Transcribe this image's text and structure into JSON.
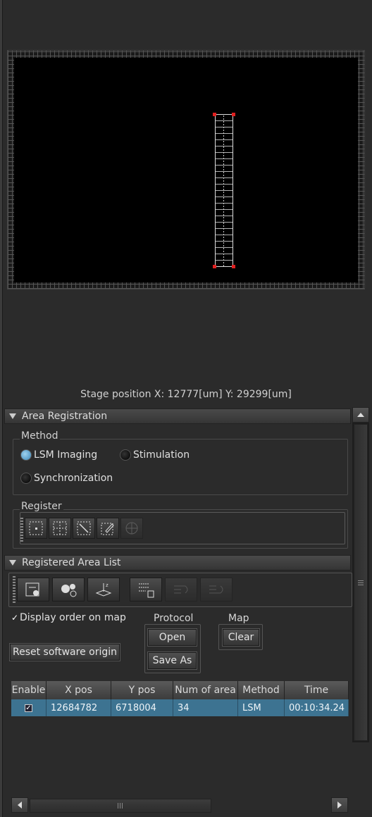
{
  "stage_position": "Stage position  X: 12777[um] Y: 29299[um]",
  "area_registration": {
    "header": "Area Registration",
    "method_title": "Method",
    "methods": [
      "LSM Imaging",
      "Stimulation",
      "Synchronization"
    ],
    "selected_method": "LSM Imaging",
    "register_title": "Register",
    "register_tools": [
      "point-register-icon",
      "grid-register-icon",
      "diagonal-register-icon",
      "edit-register-icon",
      "multi-area-icon"
    ]
  },
  "registered_area_list": {
    "header": "Registered Area List",
    "tools": [
      "list-settings-icon",
      "camera-settings-icon",
      "z-axis-icon",
      "delete-list-icon",
      "move-up-icon",
      "move-down-icon"
    ],
    "display_order_label": "Display order on map",
    "display_order_checked": true,
    "protocol_title": "Protocol",
    "open_label": "Open",
    "save_as_label": "Save As",
    "map_title": "Map",
    "clear_label": "Clear",
    "reset_label": "Reset software origin",
    "table": {
      "columns": [
        "Enable",
        "X pos",
        "Y pos",
        "Num of area",
        "Method",
        "Time"
      ],
      "rows": [
        {
          "enable": true,
          "x_pos": "12684782",
          "y_pos": "6718004",
          "num_of_area": "34",
          "method": "LSM",
          "time": "00:10:34.24"
        }
      ]
    }
  },
  "colors": {
    "selection": "#3d7391",
    "accent_red": "#e02020",
    "radio_on": "#3a86b8"
  }
}
